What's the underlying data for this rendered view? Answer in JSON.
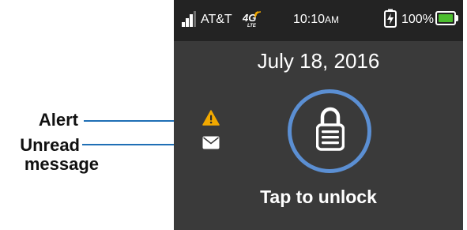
{
  "callouts": {
    "alert_label": "Alert",
    "unread_line1": "Unread",
    "unread_line2": "message",
    "leader_color": "#1f6fb5"
  },
  "status_bar": {
    "carrier": "AT&T",
    "network": "4G LTE",
    "time": "10:10",
    "ampm": "AM",
    "battery_percent": "100%",
    "battery_level": 1.0,
    "battery_color": "#4cbe2f",
    "icons": [
      "signal-icon",
      "lte-icon",
      "charging-icon",
      "battery-icon"
    ]
  },
  "lock_screen": {
    "date": "July 18, 2016",
    "tap_label": "Tap to unlock",
    "ring_color": "#5b8fd3",
    "background": "#3a3a3a",
    "notification_icons": [
      "alert-icon",
      "mail-icon"
    ],
    "alert_color": "#f2a900"
  }
}
